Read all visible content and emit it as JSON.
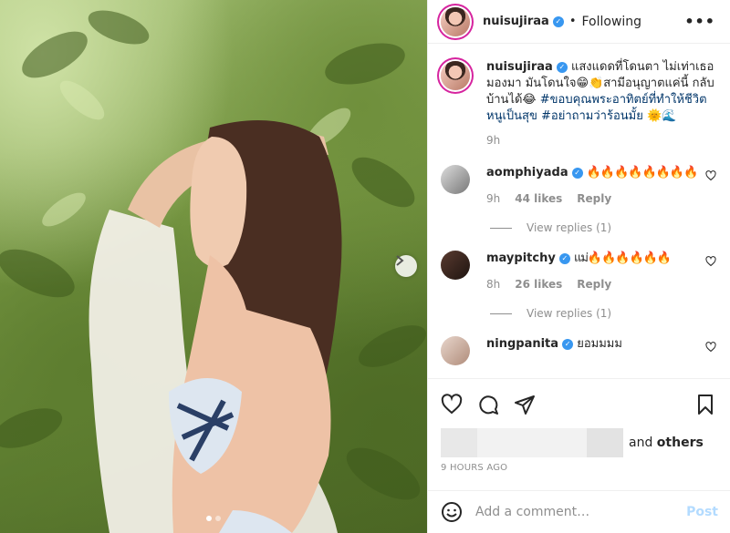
{
  "post": {
    "author": "nuisujiraa",
    "follow_status": "Following",
    "separator": "•",
    "more_label": "•••"
  },
  "caption": {
    "username": "nuisujiraa",
    "text_line": "แสงแดดที่โดนตา ไม่เท่าเธอมองมา มันโดนใจ😁👏สามีอนุญาตแค่นี้ กลับบ้านได้😂",
    "hashtag1": "#ขอบคุณพระอาทิตย์ที่ทำให้ชีวิตหนูเป็นสุข",
    "hashtag2": "#อย่าถามว่าร้อนมั้ย",
    "emoji_tail": "🌞🌊",
    "time": "9h"
  },
  "comments": [
    {
      "username": "aomphiyada",
      "text": "🔥🔥🔥🔥🔥🔥🔥🔥",
      "time": "9h",
      "likes": "44 likes",
      "reply": "Reply",
      "view_replies": "View replies (1)"
    },
    {
      "username": "maypitchy",
      "text": "แม่🔥🔥🔥🔥🔥🔥",
      "time": "8h",
      "likes": "26 likes",
      "reply": "Reply",
      "view_replies": "View replies (1)"
    },
    {
      "username": "ningpanita",
      "text": "ยอมมมม"
    }
  ],
  "likes": {
    "suffix": "and",
    "others": "others"
  },
  "timestamp": "9 HOURS AGO",
  "add_comment": {
    "placeholder": "Add a comment…",
    "post_label": "Post"
  },
  "carousel": {
    "active_index": 0,
    "count": 2
  },
  "icons": [
    "heart-icon",
    "comment-icon",
    "share-icon",
    "bookmark-icon",
    "emoji-icon",
    "chevron-right-icon",
    "verified-icon"
  ],
  "colors": {
    "link": "#003569",
    "verified": "#3897f0",
    "muted": "#8e8e8e",
    "post_button": "#b3dbff"
  }
}
